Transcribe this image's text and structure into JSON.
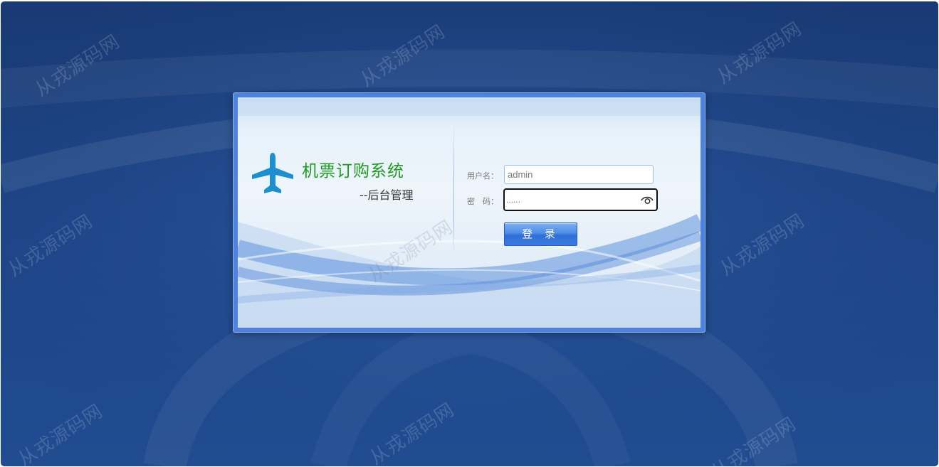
{
  "app": {
    "title": "机票订购系统",
    "subtitle": "--后台管理"
  },
  "form": {
    "username_label": "用户名：",
    "username_value": "admin",
    "password_label": "密　码：",
    "password_value": "......",
    "login_label": "登 录"
  },
  "icons": {
    "logo": "airplane-icon",
    "password_toggle": "eye-icon"
  },
  "watermark": "从戎源码网",
  "colors": {
    "background": "#1d4485",
    "title_green": "#1e9a1e",
    "button_blue": "#3b7be0",
    "plane_blue": "#1d8fcf"
  }
}
